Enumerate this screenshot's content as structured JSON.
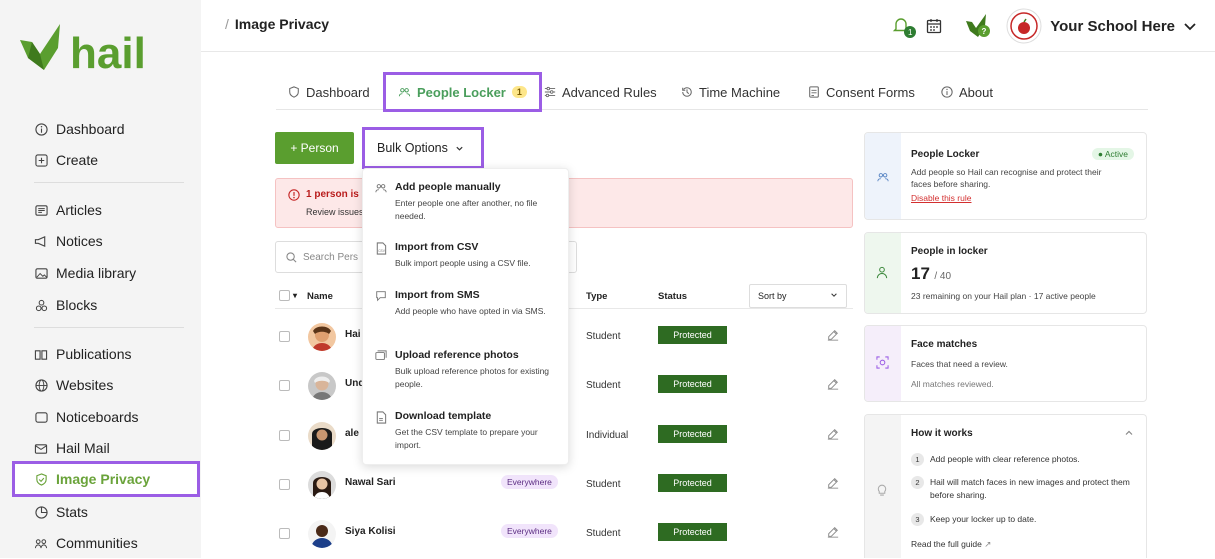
{
  "app": {
    "brand": "hail",
    "brand_color": "#5a9e2f",
    "accent": "#9b5de5"
  },
  "sidebar": {
    "items": [
      {
        "label": "Dashboard",
        "icon": "info-icon"
      },
      {
        "label": "Create",
        "icon": "plus-square-icon"
      },
      {
        "label": "Articles",
        "icon": "article-icon"
      },
      {
        "label": "Notices",
        "icon": "megaphone-icon"
      },
      {
        "label": "Media library",
        "icon": "image-icon"
      },
      {
        "label": "Blocks",
        "icon": "blocks-icon"
      },
      {
        "label": "Publications",
        "icon": "book-icon"
      },
      {
        "label": "Websites",
        "icon": "globe-icon"
      },
      {
        "label": "Noticeboards",
        "icon": "noticeboard-icon"
      },
      {
        "label": "Hail Mail",
        "icon": "mail-icon"
      },
      {
        "label": "Image Privacy",
        "icon": "shield-icon"
      },
      {
        "label": "Stats",
        "icon": "chart-icon"
      },
      {
        "label": "Communities",
        "icon": "communities-icon"
      }
    ]
  },
  "topbar": {
    "breadcrumb_sep": "/",
    "breadcrumb": "Image Privacy",
    "notif_count": "1",
    "school_name": "Your School Here"
  },
  "tabs": [
    {
      "label": "Dashboard",
      "icon": "shield-icon"
    },
    {
      "label": "People Locker",
      "icon": "people-icon",
      "badge": "1"
    },
    {
      "label": "Advanced Rules",
      "icon": "sliders-icon"
    },
    {
      "label": "Time Machine",
      "icon": "history-icon"
    },
    {
      "label": "Consent Forms",
      "icon": "form-icon"
    },
    {
      "label": "About",
      "icon": "info-icon"
    }
  ],
  "actions": {
    "add_person": "+ Person",
    "bulk_options": "Bulk Options"
  },
  "alert": {
    "title": "1 person is n",
    "subtitle": "Review issues"
  },
  "search": {
    "placeholder": "Search Pers"
  },
  "table": {
    "headers": {
      "name": "Name",
      "type": "Type",
      "status": "Status",
      "sort": "Sort by"
    },
    "rows": [
      {
        "name": "Hai",
        "tag": "",
        "type": "Student",
        "status": "Protected"
      },
      {
        "name": "Und",
        "tag": "",
        "type": "Student",
        "status": "Protected"
      },
      {
        "name": "ale",
        "tag": "",
        "type": "Individual",
        "status": "Protected"
      },
      {
        "name": "Nawal Sari",
        "tag": "Everywhere",
        "type": "Student",
        "status": "Protected"
      },
      {
        "name": "Siya Kolisi",
        "tag": "Everywhere",
        "type": "Student",
        "status": "Protected"
      }
    ]
  },
  "bulk_menu": [
    {
      "title": "Add people manually",
      "desc": "Enter people one after another, no file needed.",
      "icon": "people-icon"
    },
    {
      "title": "Import from CSV",
      "desc": "Bulk import people using a CSV file.",
      "icon": "csv-file-icon"
    },
    {
      "title": "Import from SMS",
      "desc": "Add people who have opted in via SMS.",
      "icon": "chat-icon"
    },
    {
      "title": "Upload reference photos",
      "desc": "Bulk upload reference photos for existing people.",
      "icon": "photos-icon"
    },
    {
      "title": "Download template",
      "desc": "Get the CSV template to prepare your import.",
      "icon": "file-icon"
    }
  ],
  "cards": {
    "locker": {
      "title": "People Locker",
      "status": "Active",
      "desc": "Add people so Hail can recognise and protect their faces before sharing.",
      "link": "Disable this rule"
    },
    "count": {
      "title": "People in locker",
      "value": "17",
      "total": "/ 40",
      "desc": "23 remaining on your Hail plan · 17 active people"
    },
    "faces": {
      "title": "Face matches",
      "desc": "Faces that need a review.",
      "note": "All matches reviewed."
    },
    "how": {
      "title": "How it works",
      "steps": [
        {
          "n": "1",
          "text": "Add people with clear reference photos."
        },
        {
          "n": "2",
          "text": "Hail will match faces in new images and protect them before sharing."
        },
        {
          "n": "3",
          "text": "Keep your locker up to date."
        }
      ],
      "link": "Read the full guide"
    }
  }
}
